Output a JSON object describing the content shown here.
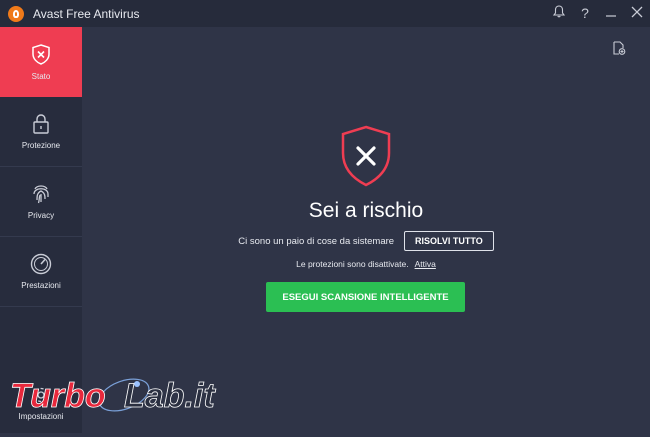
{
  "window": {
    "title": "Avast Free Antivirus",
    "controls": [
      "bell-icon",
      "help-icon",
      "minimize-icon",
      "close-icon"
    ]
  },
  "sidebar": {
    "items": [
      {
        "label": "Stato",
        "icon": "shield-x-icon",
        "active": true
      },
      {
        "label": "Protezione",
        "icon": "lock-icon",
        "active": false
      },
      {
        "label": "Privacy",
        "icon": "fingerprint-icon",
        "active": false
      },
      {
        "label": "Prestazioni",
        "icon": "speedometer-icon",
        "active": false
      },
      {
        "label": "Impostazioni",
        "icon": "gear-icon",
        "active": false
      }
    ]
  },
  "main": {
    "status_title": "Sei a rischio",
    "issues_text": "Ci sono un paio di cose da sistemare",
    "resolve_button": "RISOLVI TUTTO",
    "protection_text": "Le protezioni sono disattivate.",
    "activate_link": "Attiva",
    "scan_button": "ESEGUI SCANSIONE INTELLIGENTE"
  },
  "watermark": {
    "part1": "Turbo",
    "part2": "Lab.it"
  },
  "colors": {
    "accent_red": "#ef3d52",
    "scan_green": "#2bbf53",
    "background": "#2f3447",
    "sidebar": "#272c3d"
  }
}
